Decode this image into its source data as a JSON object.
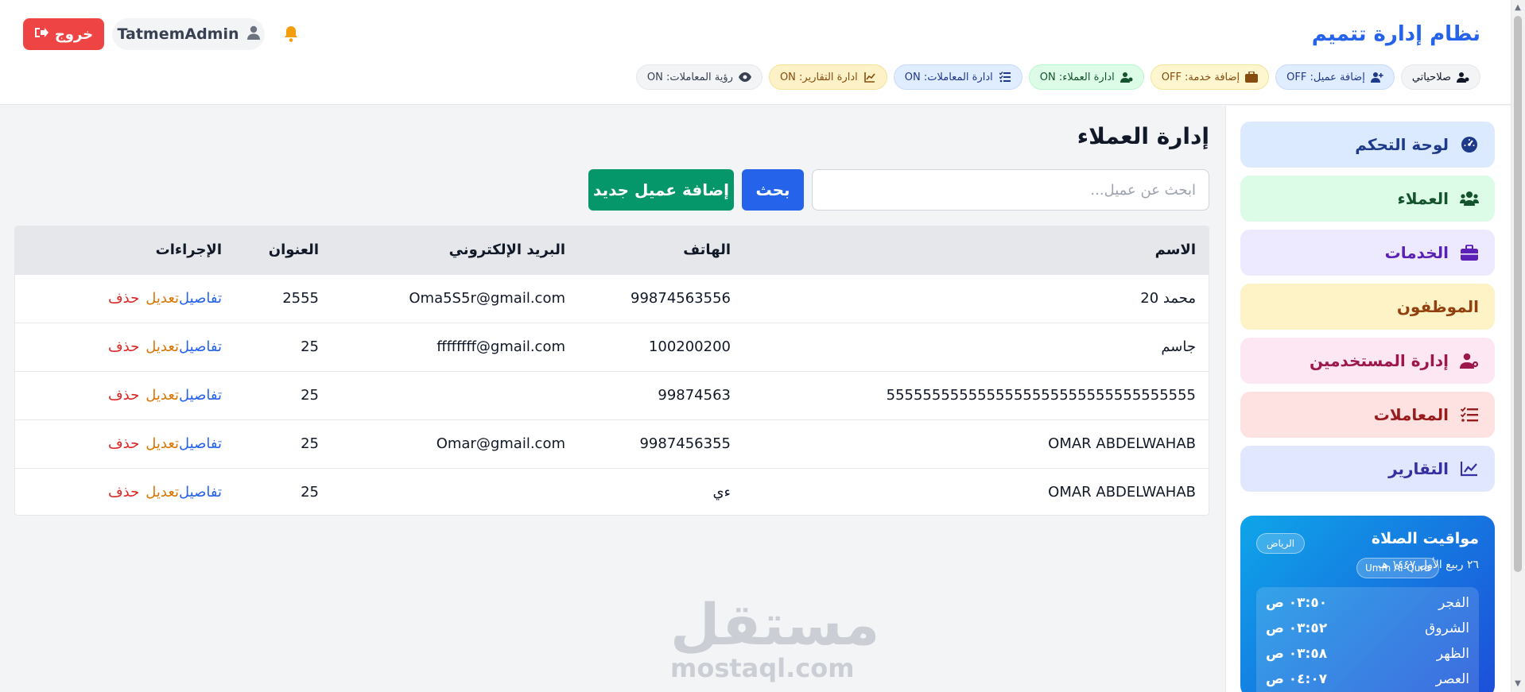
{
  "header": {
    "app_title": "نظام إدارة تتميم",
    "logout_label": "خروج",
    "username": "TatmemAdmin"
  },
  "permissions": {
    "mine_label": "صلاحياتي",
    "items": [
      {
        "label": "إضافة عميل: OFF",
        "icon": "user-plus-icon"
      },
      {
        "label": "إضافة خدمة: OFF",
        "icon": "briefcase-icon"
      },
      {
        "label": "ادارة العملاء: ON",
        "icon": "user-gear-icon"
      },
      {
        "label": "ادارة المعاملات: ON",
        "icon": "list-check-icon"
      },
      {
        "label": "ادارة التقارير: ON",
        "icon": "chart-line-icon"
      },
      {
        "label": "رؤية المعاملات: ON",
        "icon": "eye-icon"
      }
    ]
  },
  "sidebar": {
    "items": [
      {
        "label": "لوحة التحكم",
        "icon": "dashboard-icon",
        "bg": "#dbeafe",
        "color": "#1e3a8a"
      },
      {
        "label": "العملاء",
        "icon": "users-icon",
        "bg": "#dcfce7",
        "color": "#14532d"
      },
      {
        "label": "الخدمات",
        "icon": "briefcase-icon",
        "bg": "#ede9fe",
        "color": "#5b21b6"
      },
      {
        "label": "الموظفون",
        "icon": "",
        "bg": "#fef3c7",
        "color": "#92400e"
      },
      {
        "label": "إدارة المستخدمين",
        "icon": "user-gear-icon",
        "bg": "#fce7f3",
        "color": "#9d174d"
      },
      {
        "label": "المعاملات",
        "icon": "list-check-icon",
        "bg": "#fee2e2",
        "color": "#991b1b"
      },
      {
        "label": "التقارير",
        "icon": "chart-line-icon",
        "bg": "#e0e7ff",
        "color": "#3730a3"
      }
    ]
  },
  "prayer": {
    "title": "مواقيت الصلاة",
    "city": "الرياض",
    "hijri_date": "٢٦ ربيع الأول ١٤٤٧ هـ",
    "calendar": "Umm Al-Qura",
    "times": [
      {
        "name": "الفجر",
        "time": "٠٣:٥٠ ص"
      },
      {
        "name": "الشروق",
        "time": "٠٣:٥٢ ص"
      },
      {
        "name": "الظهر",
        "time": "٠٣:٥٨ ص"
      },
      {
        "name": "العصر",
        "time": "٠٤:٠٧ ص"
      }
    ]
  },
  "main": {
    "page_title": "إدارة العملاء",
    "search_placeholder": "ابحث عن عميل...",
    "search_value": "",
    "search_label": "بحث",
    "add_label": "إضافة عميل جديد"
  },
  "table": {
    "headers": {
      "name": "الاسم",
      "phone": "الهاتف",
      "email": "البريد الإلكتروني",
      "address": "العنوان",
      "actions": "الإجراءات"
    },
    "action_labels": {
      "details": "تفاصيل",
      "edit": "تعديل",
      "delete": "حذف"
    },
    "rows": [
      {
        "name": "محمد 20",
        "phone": "99874563556",
        "email": "Oma5S5r@gmail.com",
        "address": "2555"
      },
      {
        "name": "جاسم",
        "phone": "100200200",
        "email": "ffffffff@gmail.com",
        "address": "25"
      },
      {
        "name": "5555555555555555555555555555555555",
        "phone": "99874563",
        "email": "",
        "address": "25"
      },
      {
        "name": "OMAR ABDELWAHAB",
        "phone": "9987456355",
        "email": "Omar@gmail.com",
        "address": "25"
      },
      {
        "name": "OMAR ABDELWAHAB",
        "phone": "ءي",
        "email": "",
        "address": "25"
      }
    ]
  },
  "watermark": {
    "arabic": "مستقل",
    "latin": "mostaql.com"
  }
}
